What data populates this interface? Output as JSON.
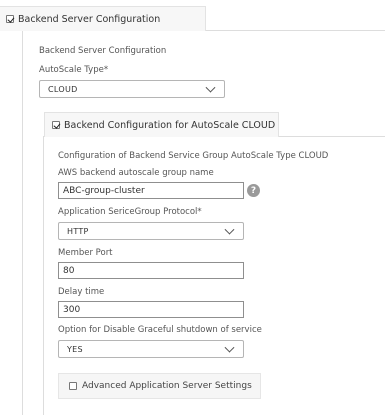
{
  "backend_section": {
    "legend_label": "Backend Server Configuration",
    "legend_checked": true,
    "heading": "Backend Server Configuration",
    "autoscale_type_label": "AutoScale Type*",
    "autoscale_type_value": "CLOUD"
  },
  "cloud_section": {
    "legend_label": "Backend Configuration for AutoScale CLOUD",
    "legend_checked": true,
    "heading": "Configuration of Backend Service Group AutoScale Type CLOUD",
    "aws_group_label": "AWS backend autoscale group name",
    "aws_group_value": "ABC-group-cluster",
    "help_glyph": "?",
    "protocol_label": "Application SericeGroup Protocol*",
    "protocol_value": "HTTP",
    "member_port_label": "Member Port",
    "member_port_value": "80",
    "delay_label": "Delay time",
    "delay_value": "300",
    "graceful_label": "Option for Disable Graceful shutdown of service",
    "graceful_value": "YES",
    "advanced_label": "Advanced Application Server Settings",
    "advanced_checked": false
  },
  "icons": {
    "checkbox_checked": "checkbox-checked-icon",
    "checkbox_unchecked": "checkbox-unchecked-icon",
    "dropdown": "chevron-down-icon",
    "help": "help-icon"
  }
}
